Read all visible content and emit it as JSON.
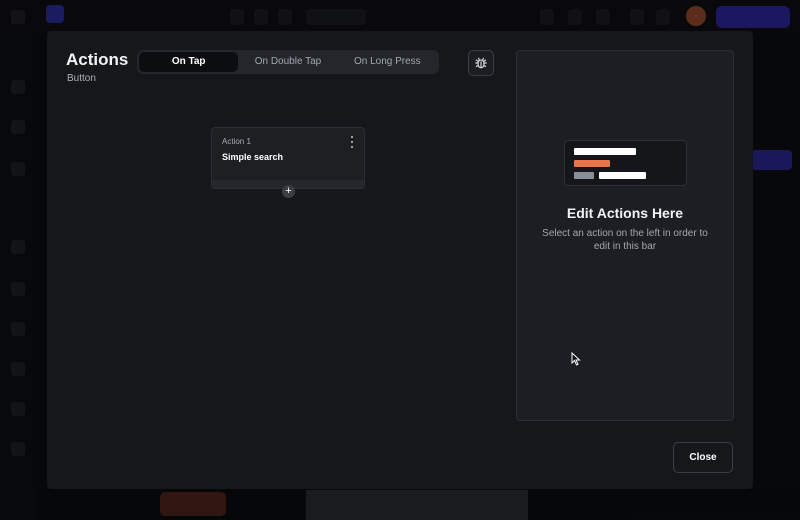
{
  "modal": {
    "title": "Actions",
    "subtitle": "Button",
    "tabs": [
      {
        "label": "On Tap",
        "active": true
      },
      {
        "label": "On Double Tap",
        "active": false
      },
      {
        "label": "On Long Press",
        "active": false
      }
    ],
    "debug_icon": "bug-icon",
    "action_card": {
      "number_label": "Action 1",
      "name": "Simple search",
      "menu_icon": "more-vertical-icon"
    },
    "add_icon": "plus-icon",
    "empty_state": {
      "title": "Edit Actions Here",
      "description": "Select an action on the left in order to edit in this bar"
    },
    "close_label": "Close"
  },
  "colors": {
    "modal_bg": "#15171b",
    "accent_orange": "#e8744a",
    "bar_white": "#ffffff",
    "bar_gray": "#8a8f97"
  }
}
